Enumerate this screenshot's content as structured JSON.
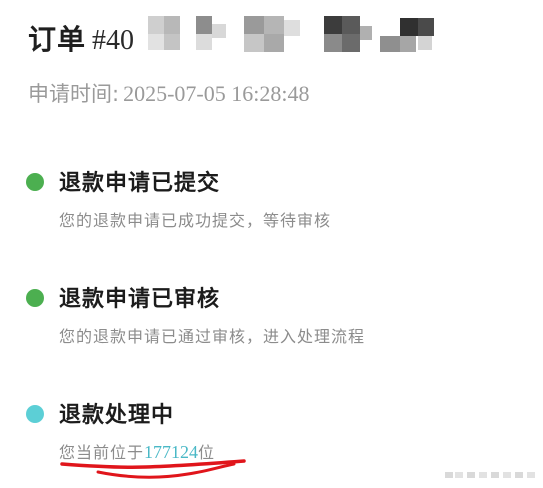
{
  "order": {
    "label": "订单",
    "number_visible": "#40"
  },
  "apply_time": {
    "label": "申请时间:",
    "value": "2025-07-05 16:28:48"
  },
  "steps": [
    {
      "title": "退款申请已提交",
      "description": "您的退款申请已成功提交，等待审核",
      "status_color": "#4caf50"
    },
    {
      "title": "退款申请已审核",
      "description": "您的退款申请已通过审核，进入处理流程",
      "status_color": "#4caf50"
    },
    {
      "title": "退款处理中",
      "description_prefix": "您当前位于",
      "queue_position": "177124",
      "description_suffix": "位",
      "status_color": "#5ccfd6"
    }
  ],
  "colors": {
    "highlight": "#49b8c6",
    "annotation": "#e0151b"
  }
}
